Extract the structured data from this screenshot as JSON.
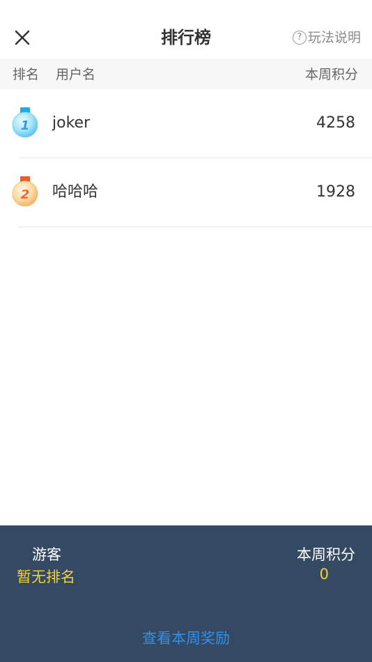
{
  "header": {
    "title": "排行榜",
    "help_label": "玩法说明",
    "help_icon": "question-circle-icon",
    "close_icon": "close-icon"
  },
  "columns": {
    "rank": "排名",
    "user": "用户名",
    "score": "本周积分"
  },
  "leaderboard": [
    {
      "rank": "1",
      "name": "joker",
      "score": "4258",
      "medal": "blue-medal-icon"
    },
    {
      "rank": "2",
      "name": "哈哈哈",
      "score": "1928",
      "medal": "orange-medal-icon"
    }
  ],
  "footer": {
    "user_name": "游客",
    "rank_text": "暂无排名",
    "score_label": "本周积分",
    "score_value": "0",
    "rewards_link": "查看本周奖励"
  },
  "colors": {
    "footer_bg": "#344a63",
    "highlight_yellow": "#f5d033",
    "link_blue": "#2f8ff0"
  }
}
